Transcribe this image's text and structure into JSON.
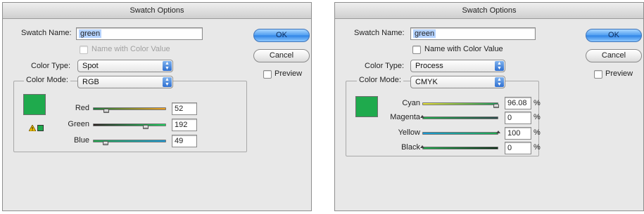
{
  "swatch_color": "#1faa4d",
  "dialogs": [
    {
      "title": "Swatch Options",
      "swatch_name_label": "Swatch Name:",
      "swatch_name_value": "green",
      "name_with_color_value_label": "Name with Color Value",
      "color_type_label": "Color Type:",
      "color_type_value": "Spot",
      "color_mode_label": "Color Mode:",
      "color_mode_value": "RGB",
      "ok_label": "OK",
      "cancel_label": "Cancel",
      "preview_label": "Preview",
      "sliders": [
        {
          "label": "Red",
          "value": "52",
          "unit": "",
          "gradient": [
            "#1b7a3a",
            "#f0a020"
          ]
        },
        {
          "label": "Green",
          "value": "192",
          "unit": "",
          "gradient": [
            "#2a1f1f",
            "#1fd060"
          ]
        },
        {
          "label": "Blue",
          "value": "49",
          "unit": "",
          "gradient": [
            "#1fa64a",
            "#1a9ad8"
          ]
        }
      ]
    },
    {
      "title": "Swatch Options",
      "swatch_name_label": "Swatch Name:",
      "swatch_name_value": "green",
      "name_with_color_value_label": "Name with Color Value",
      "color_type_label": "Color Type:",
      "color_type_value": "Process",
      "color_mode_label": "Color Mode:",
      "color_mode_value": "CMYK",
      "ok_label": "OK",
      "cancel_label": "Cancel",
      "preview_label": "Preview",
      "sliders": [
        {
          "label": "Cyan",
          "value": "96.08",
          "unit": "%",
          "gradient": [
            "#e8e23a",
            "#1e9a5a"
          ]
        },
        {
          "label": "Magenta",
          "value": "0",
          "unit": "%",
          "gradient": [
            "#1faa4d",
            "#2a4a4a"
          ]
        },
        {
          "label": "Yellow",
          "value": "100",
          "unit": "%",
          "gradient": [
            "#1a9ad8",
            "#1faa4d"
          ]
        },
        {
          "label": "Black",
          "value": "0",
          "unit": "%",
          "gradient": [
            "#1faa4d",
            "#0a2a14"
          ]
        }
      ]
    }
  ]
}
